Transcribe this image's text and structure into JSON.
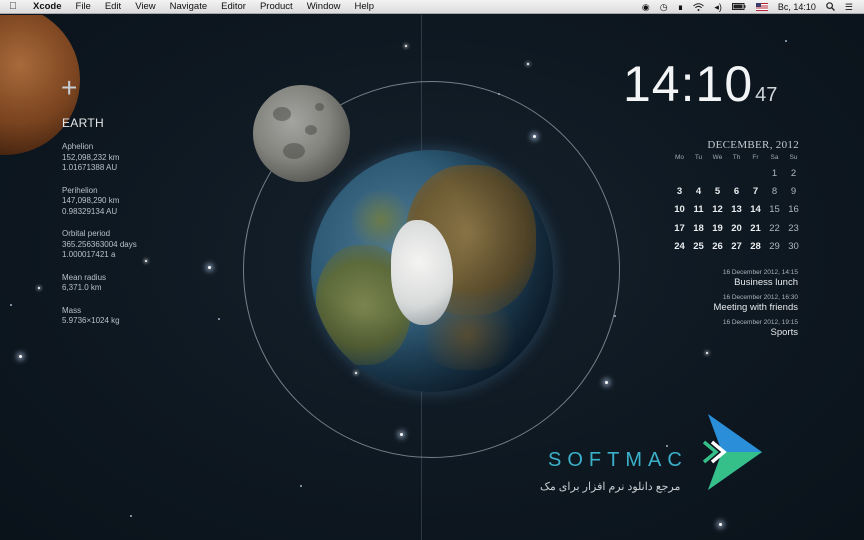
{
  "menubar": {
    "app_name": "Xcode",
    "menus": [
      "File",
      "Edit",
      "View",
      "Navigate",
      "Editor",
      "Product",
      "Window",
      "Help"
    ],
    "clock": "Вс, 14:10",
    "icons": [
      "apple-icon",
      "record-icon",
      "time-machine-icon",
      "bluetooth-icon",
      "wifi-icon",
      "volume-icon",
      "battery-icon",
      "flag-us-icon",
      "search-icon",
      "list-icon"
    ]
  },
  "planet": {
    "name": "EARTH",
    "facts": [
      {
        "label": "Aphelion",
        "lines": [
          "152,098,232 km",
          "1.01671388 AU"
        ]
      },
      {
        "label": "Perihelion",
        "lines": [
          "147,098,290 km",
          "0.98329134 AU"
        ]
      },
      {
        "label": "Orbital period",
        "lines": [
          "365.256363004 days",
          "1.000017421 a"
        ]
      },
      {
        "label": "Mean radius",
        "lines": [
          "6,371.0 km"
        ]
      },
      {
        "label": "Mass",
        "lines": [
          "5.9736×1024 kg"
        ]
      }
    ]
  },
  "clock": {
    "hours_minutes": "14:10",
    "seconds": "47"
  },
  "calendar": {
    "month_label": "DECEMBER, 2012",
    "weekdays": [
      "Mo",
      "Tu",
      "We",
      "Th",
      "Fr",
      "Sa",
      "Su"
    ],
    "weeks": [
      [
        "",
        "",
        "",
        "",
        "",
        "1",
        "2"
      ],
      [
        "3",
        "4",
        "5",
        "6",
        "7",
        "8",
        "9"
      ],
      [
        "10",
        "11",
        "12",
        "13",
        "14",
        "15",
        "16"
      ],
      [
        "17",
        "18",
        "19",
        "20",
        "21",
        "22",
        "23"
      ],
      [
        "24",
        "25",
        "26",
        "27",
        "28",
        "29",
        "30"
      ]
    ]
  },
  "events": [
    {
      "when": "16 December 2012, 14:15",
      "what": "Business lunch"
    },
    {
      "when": "16 December 2012, 16:30",
      "what": "Meeting with friends"
    },
    {
      "when": "16 December 2012, 19:15",
      "what": "Sports"
    }
  ],
  "watermark": {
    "brand": "SOFTMAC",
    "tagline": "مرجع دانلود نرم افزار برای مک"
  },
  "colors": {
    "space": "#0d1620",
    "brand": "#3bb0c9",
    "logo_blue": "#2a8fd8",
    "logo_green": "#35c08a"
  }
}
